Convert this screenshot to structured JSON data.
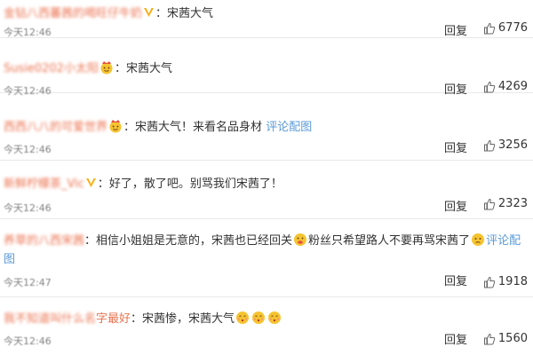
{
  "comments": [
    {
      "username": "金钻八西蕃茜的喝旺仔牛奶",
      "badge": "v-badge-icon",
      "text": "宋茜大气",
      "time": "今天12:46",
      "reply_label": "回复",
      "likes": "6776"
    },
    {
      "username": "Susie0202小太阳",
      "badge": "crown-emoji-icon",
      "text": "宋茜大气",
      "time": "今天12:46",
      "reply_label": "回复",
      "likes": "4269"
    },
    {
      "username": "西西八八的可爱世界",
      "badge": "crown-emoji-icon",
      "text": "宋茜大气！来看名品身材",
      "link_text": "评论配图",
      "time": "今天12:46",
      "reply_label": "回复",
      "likes": "3256"
    },
    {
      "username": "新鲜柠檬茶_Vic",
      "badge": "v-badge-icon",
      "text": "好了，散了吧。别骂我们宋茜了！",
      "time": "今天12:46",
      "reply_label": "回复",
      "likes": "2323"
    },
    {
      "username": "养草的八西宋茜",
      "text_part1": "相信小姐姐是无意的，宋茜也已经回关",
      "text_part2": "粉丝只希望路人不要再骂宋茜了",
      "link_text": "评论配",
      "wrap_text": "图",
      "time": "今天12:47",
      "reply_label": "回复",
      "likes": "1918"
    },
    {
      "username_blurred": "我不知道叫什么名",
      "username_clear": "字最好",
      "text": "宋茜惨，宋茜大气",
      "time": "今天12:46",
      "reply_label": "回复",
      "likes": "1560"
    }
  ],
  "colors": {
    "username": "#eb7350",
    "link": "#5a9ad8",
    "text": "#333333",
    "meta": "#808080"
  }
}
